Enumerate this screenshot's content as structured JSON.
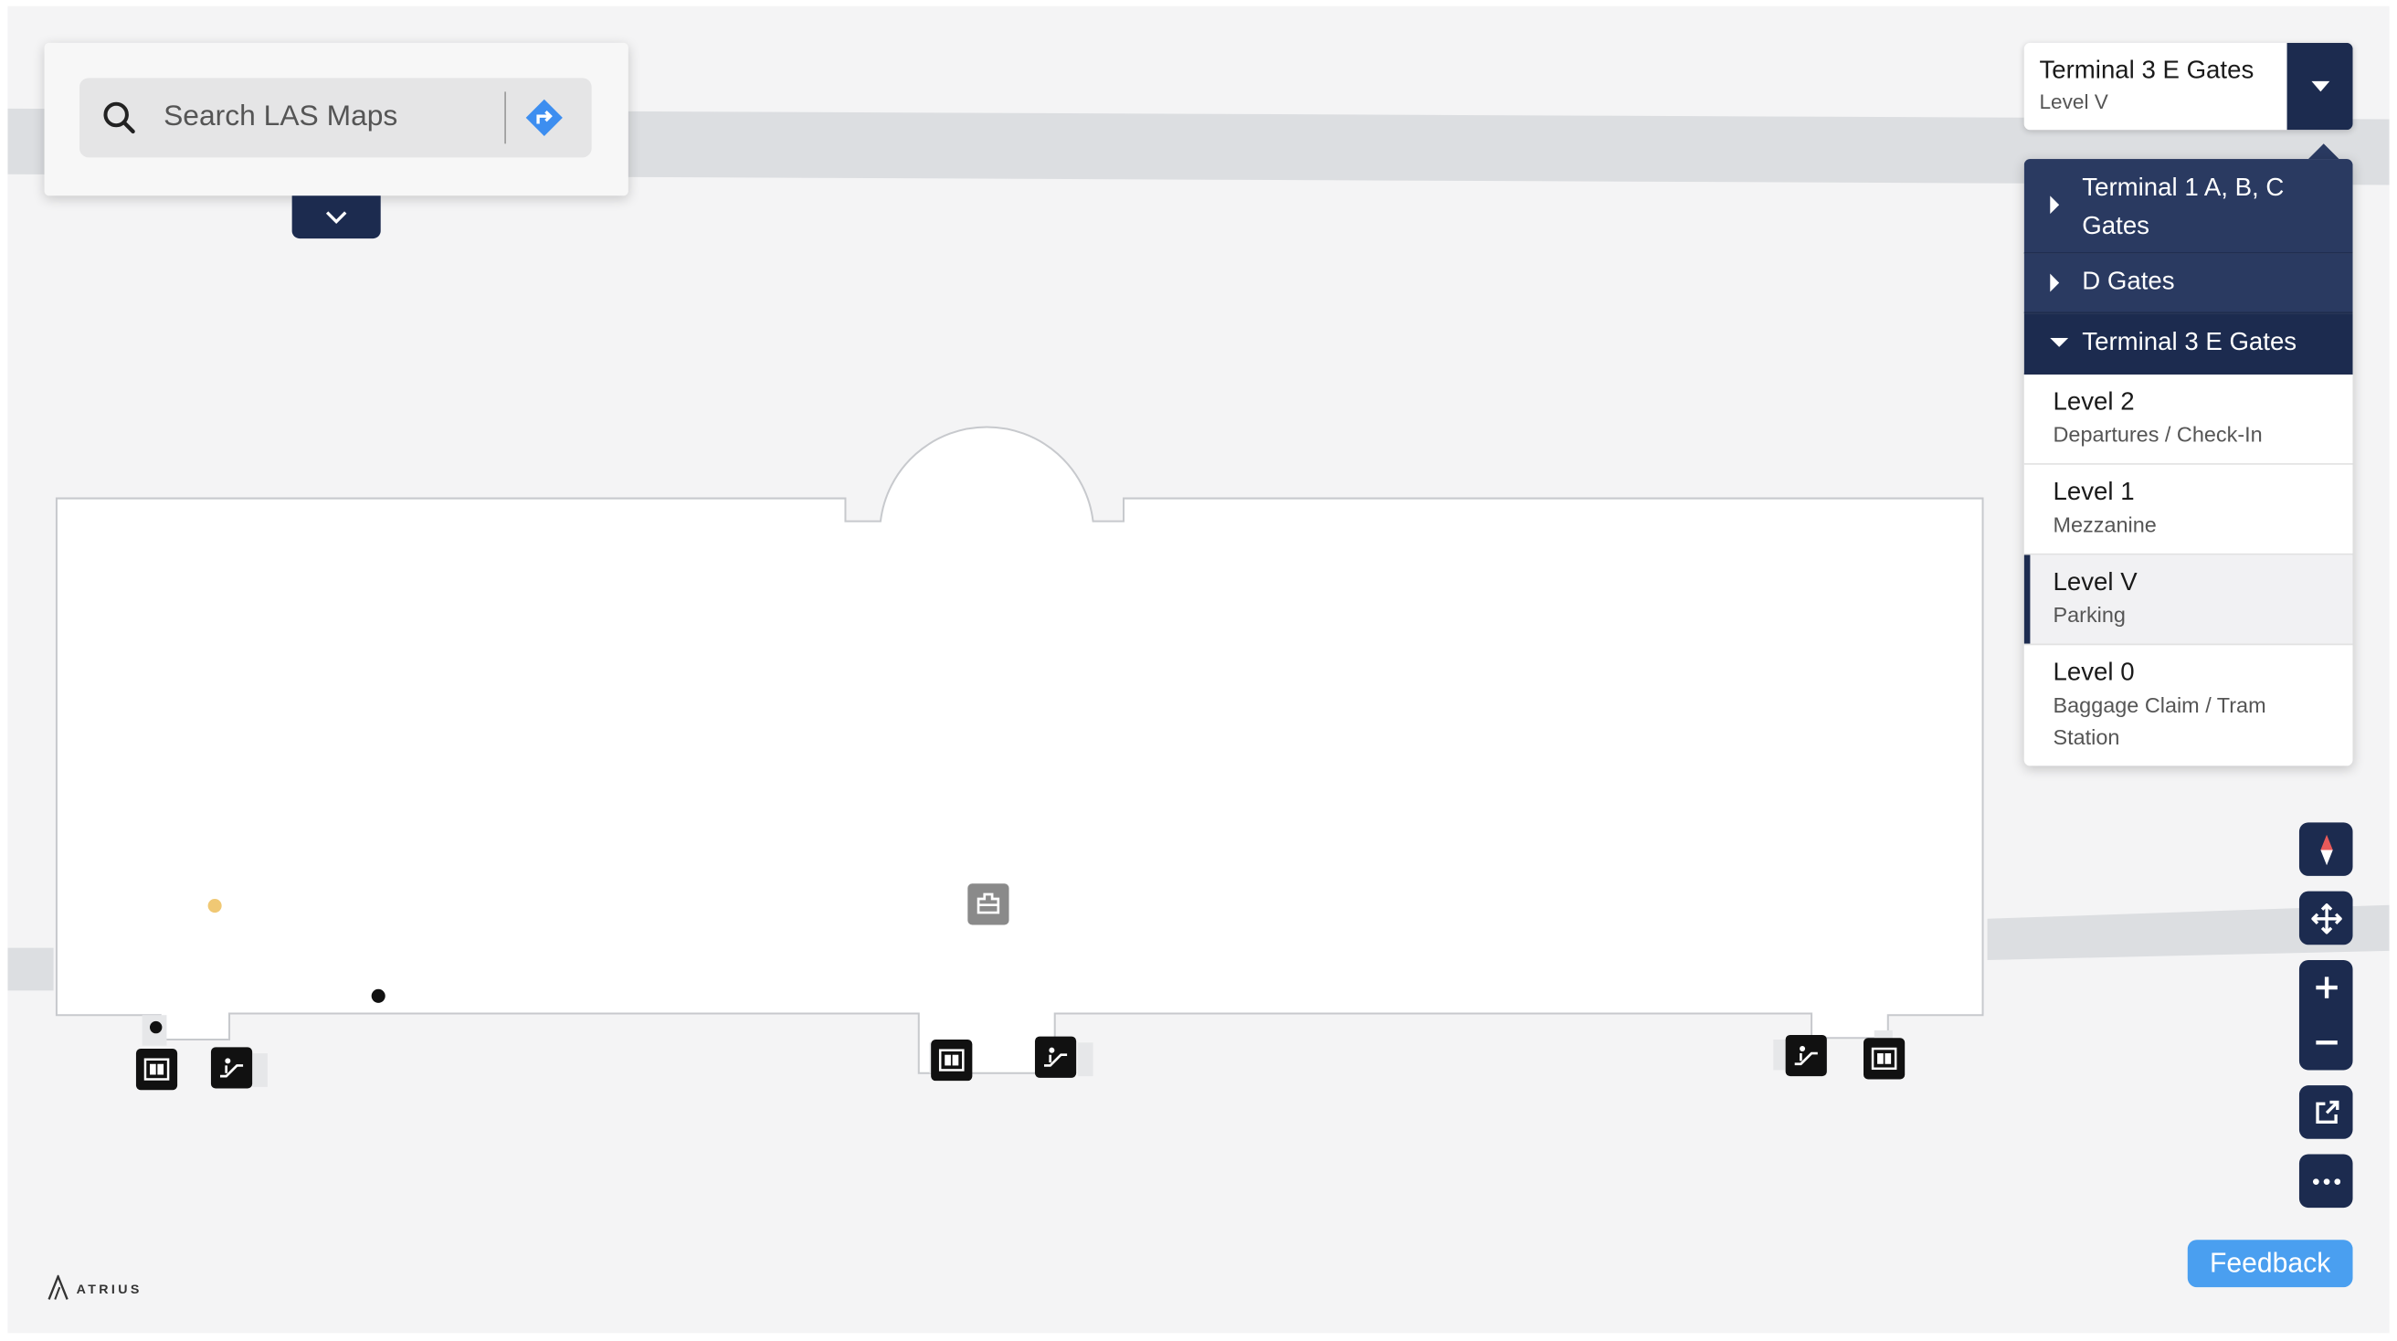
{
  "search": {
    "placeholder": "Search LAS Maps"
  },
  "building_selector": {
    "title": "Terminal 3 E Gates",
    "subtitle": "Level V"
  },
  "dropdown": {
    "buildings": [
      {
        "label": "Terminal 1 A, B, C Gates",
        "expanded": false
      },
      {
        "label": "D Gates",
        "expanded": false
      },
      {
        "label": "Terminal 3 E Gates",
        "expanded": true
      }
    ],
    "levels": [
      {
        "name": "Level 2",
        "desc": "Departures / Check-In",
        "selected": false
      },
      {
        "name": "Level 1",
        "desc": "Mezzanine",
        "selected": false
      },
      {
        "name": "Level V",
        "desc": "Parking",
        "selected": true
      },
      {
        "name": "Level 0",
        "desc": "Baggage Claim / Tram Station",
        "selected": false
      }
    ]
  },
  "feedback_label": "Feedback",
  "brand": {
    "wordmark": "ATRIUS"
  },
  "map_icons": {
    "elevator": "elevator-icon",
    "escalator": "escalator-icon",
    "amenity": "baggage-counter-icon"
  },
  "colors": {
    "navy": "#1c2b4f",
    "dropdown_navy": "#2a3a61",
    "accent_blue": "#4a9ff0",
    "map_background": "#f4f4f5",
    "corridor_gray": "#dcdee1"
  }
}
